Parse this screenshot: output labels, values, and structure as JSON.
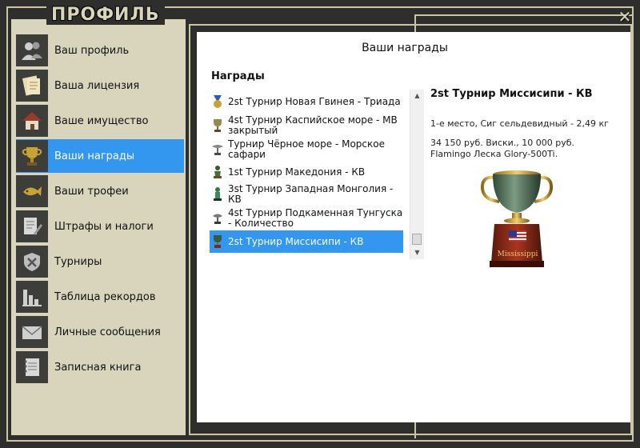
{
  "window": {
    "title": "ПРОФИЛЬ",
    "close_label": "✕"
  },
  "sidebar": {
    "items": [
      {
        "label": "Ваш профиль",
        "icon": "users-icon",
        "active": false
      },
      {
        "label": "Ваша лицензия",
        "icon": "license-icon",
        "active": false
      },
      {
        "label": "Ваше имущество",
        "icon": "house-icon",
        "active": false
      },
      {
        "label": "Ваши награды",
        "icon": "trophy-icon",
        "active": true
      },
      {
        "label": "Ваши трофеи",
        "icon": "fish-icon",
        "active": false
      },
      {
        "label": "Штрафы и налоги",
        "icon": "document-edit-icon",
        "active": false
      },
      {
        "label": "Турниры",
        "icon": "tournament-badge-icon",
        "active": false
      },
      {
        "label": "Таблица рекордов",
        "icon": "bar-chart-icon",
        "active": false
      },
      {
        "label": "Личные сообщения",
        "icon": "envelope-icon",
        "active": false
      },
      {
        "label": "Записная книга",
        "icon": "notebook-icon",
        "active": false
      }
    ]
  },
  "awards": {
    "panel_title": "Ваши награды",
    "list_heading": "Награды",
    "items": [
      {
        "label": "2st Турнир Новая Гвинея - Триада",
        "selected": false
      },
      {
        "label": "4st Турнир Каспийское море - МВ закрытый",
        "selected": false
      },
      {
        "label": "Турнир Чёрное море - Морское сафари",
        "selected": false
      },
      {
        "label": "1st Турнир Македония - КВ",
        "selected": false
      },
      {
        "label": "3st Турнир Западная Монголия - КВ",
        "selected": false
      },
      {
        "label": "4st Турнир Подкаменная Тунгуска - Количество",
        "selected": false
      },
      {
        "label": "2st Турнир Миссисипи - КВ",
        "selected": true
      }
    ],
    "detail": {
      "title": "2st Турнир Миссисипи - КВ",
      "result": "1-е место, Сиг сельдевидный - 2,49 кг",
      "prize": "34 150 руб. Виски., 10 000 руб. Flamingo Леска Glory-500Ti.",
      "trophy_plate": "Mississippi"
    }
  },
  "colors": {
    "accent": "#3397f0",
    "sidebar_bg": "#d8d5bc",
    "frame_bg": "#2e2e2c"
  }
}
